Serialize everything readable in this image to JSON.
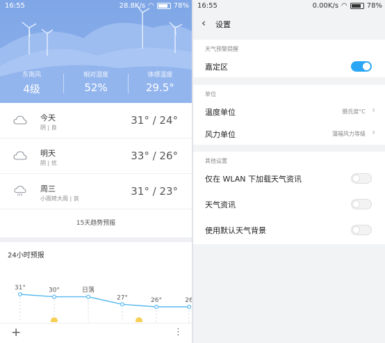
{
  "left": {
    "status": {
      "time": "16:55",
      "speed": "28.8K/s",
      "battery": "78%"
    },
    "stats": [
      {
        "label": "东南风",
        "value": "4级"
      },
      {
        "label": "相对湿度",
        "value": "52%"
      },
      {
        "label": "体感温度",
        "value": "29.5°"
      }
    ],
    "days": [
      {
        "name": "今天",
        "sub": "阴 | 良",
        "temp": "31° / 24°",
        "icon": "cloud-icon"
      },
      {
        "name": "明天",
        "sub": "阴 | 优",
        "temp": "33° / 26°",
        "icon": "cloud-icon"
      },
      {
        "name": "周三",
        "sub": "小雨转大雨 | 良",
        "temp": "31° / 23°",
        "icon": "rain-cloud-icon"
      }
    ],
    "trend_button": "15天趋势预报",
    "hourly": {
      "title": "24小时预报",
      "labels": [
        "31°",
        "30°",
        "日落",
        "27°",
        "26°",
        "26"
      ],
      "temps": [
        31,
        30,
        30,
        27,
        26,
        26
      ]
    },
    "bottom": {
      "add": "+",
      "more": "⋮"
    }
  },
  "right": {
    "status": {
      "time": "16:55",
      "speed": "0.00K/s",
      "battery": "78%"
    },
    "header": {
      "back": "‹",
      "title": "设置"
    },
    "sections": [
      {
        "label": "天气预警提醒",
        "rows": [
          {
            "label": "嘉定区",
            "toggle": true
          }
        ]
      },
      {
        "label": "单位",
        "rows": [
          {
            "label": "温度单位",
            "value": "摄氏度°C"
          },
          {
            "label": "风力单位",
            "value": "蒲福风力等级"
          }
        ]
      },
      {
        "label": "其他设置",
        "rows": [
          {
            "label": "仅在 WLAN 下加载天气资讯",
            "toggle": false
          },
          {
            "label": "天气资讯",
            "toggle": false
          },
          {
            "label": "使用默认天气背景",
            "toggle": false
          }
        ]
      }
    ]
  },
  "colors": {
    "sky": "#8bb0ea",
    "accent": "#2aa6f5",
    "line": "#57b8f0"
  }
}
